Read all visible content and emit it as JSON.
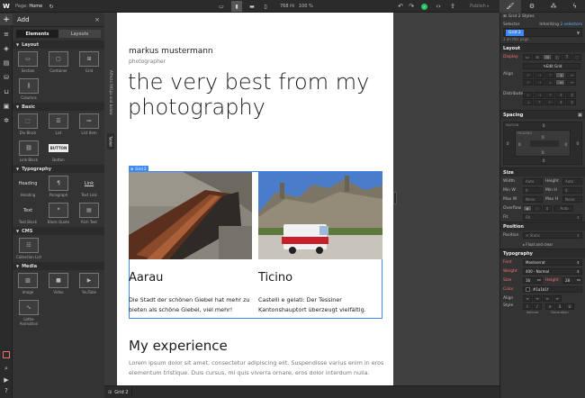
{
  "topbar": {
    "page_label": "Page:",
    "page_name": "Home",
    "width_value": "768",
    "width_unit": "PX",
    "zoom": "100 %",
    "publish_label": "Publish"
  },
  "addpanel": {
    "title": "Add",
    "tabs": [
      "Elements",
      "Layouts"
    ],
    "sections": {
      "layout": {
        "title": "Layout",
        "items": [
          "Section",
          "Container",
          "Grid",
          "Columns"
        ]
      },
      "basic": {
        "title": "Basic",
        "items": [
          "Div Block",
          "List",
          "List Item",
          "Link Block",
          "Button"
        ]
      },
      "typography": {
        "title": "Typography",
        "items": [
          "Heading",
          "Paragraph",
          "Text Link",
          "Text Block",
          "Block Quote",
          "Rich Text"
        ]
      },
      "cms": {
        "title": "CMS",
        "items": [
          "Collection List"
        ]
      },
      "media": {
        "title": "Media",
        "items": [
          "Image",
          "Video",
          "YouTube",
          "Lottie Animation"
        ]
      }
    },
    "button_glyph": "BUTTON",
    "heading_glyph": "Heading",
    "link_glyph": "Link",
    "text_glyph": "Text"
  },
  "navstrip": {
    "label1": "Affects 991px and below",
    "label2": "Tablet"
  },
  "canvas": {
    "name": "markus mustermann",
    "subtitle": "photographer",
    "hero": "the very best from my photography",
    "grid_tag": "Grid 2",
    "cards": [
      {
        "title": "Aarau",
        "text": "Die Stadt der schönen Giebel hat mehr zu bieten als schöne Giebel, viel mehr!"
      },
      {
        "title": "Ticino",
        "text": "Castelli e gelati: Der Tessiner Kantonshauptort überzeugt vielfältig."
      }
    ],
    "experience_title": "My experience",
    "experience_text": "Lorem ipsum dolor sit amet, consectetur adipiscing elit. Suspendisse varius enim in eros elementum tristique. Duis cursus, mi quis viverra ornare, eros dolor interdum nulla."
  },
  "bottombar": {
    "breadcrumb": "Grid 2"
  },
  "stylepanel": {
    "element_label": "Grid 2 Styles",
    "selector_label": "Selector",
    "inheriting_label": "Inheriting",
    "inheriting_count": "2 selectors",
    "selector_chip": "Grid 2",
    "on_page": "1 on this page",
    "layout": {
      "title": "Layout",
      "display_label": "Display",
      "edit_grid": "Edit Grid",
      "align_label": "Align",
      "distribute_label": "Distribute"
    },
    "spacing": {
      "title": "Spacing",
      "margin_label": "MARGIN",
      "padding_label": "PADDING",
      "zero": "0"
    },
    "size": {
      "title": "Size",
      "width_label": "Width",
      "height_label": "Height",
      "minw_label": "Min W",
      "minh_label": "Min H",
      "maxw_label": "Max W",
      "maxh_label": "Max H",
      "auto": "Auto",
      "none": "None",
      "overflow_label": "Overflow",
      "fit_label": "Fit",
      "fit_value": "Fill",
      "overflow_auto": "Auto"
    },
    "position": {
      "title": "Position",
      "position_label": "Position",
      "position_value": "Static",
      "float_label": "Float and clear"
    },
    "typography": {
      "title": "Typography",
      "font_label": "Font",
      "font_value": "Montserrat",
      "weight_label": "Weight",
      "weight_value": "400 - Normal",
      "size_label": "Size",
      "size_value": "16",
      "size_unit": "PX",
      "height_label": "Height",
      "height_value": "28",
      "height_unit": "PX",
      "color_label": "Color",
      "color_value": "#1a1b1f",
      "align_label": "Align",
      "style_label": "Style",
      "italicize_label": "Italicize",
      "decoration_label": "Decoration"
    }
  },
  "colors": {
    "accent": "#3f89f5",
    "active_red": "#ff6f6f",
    "publish_green": "#2ac45f"
  }
}
